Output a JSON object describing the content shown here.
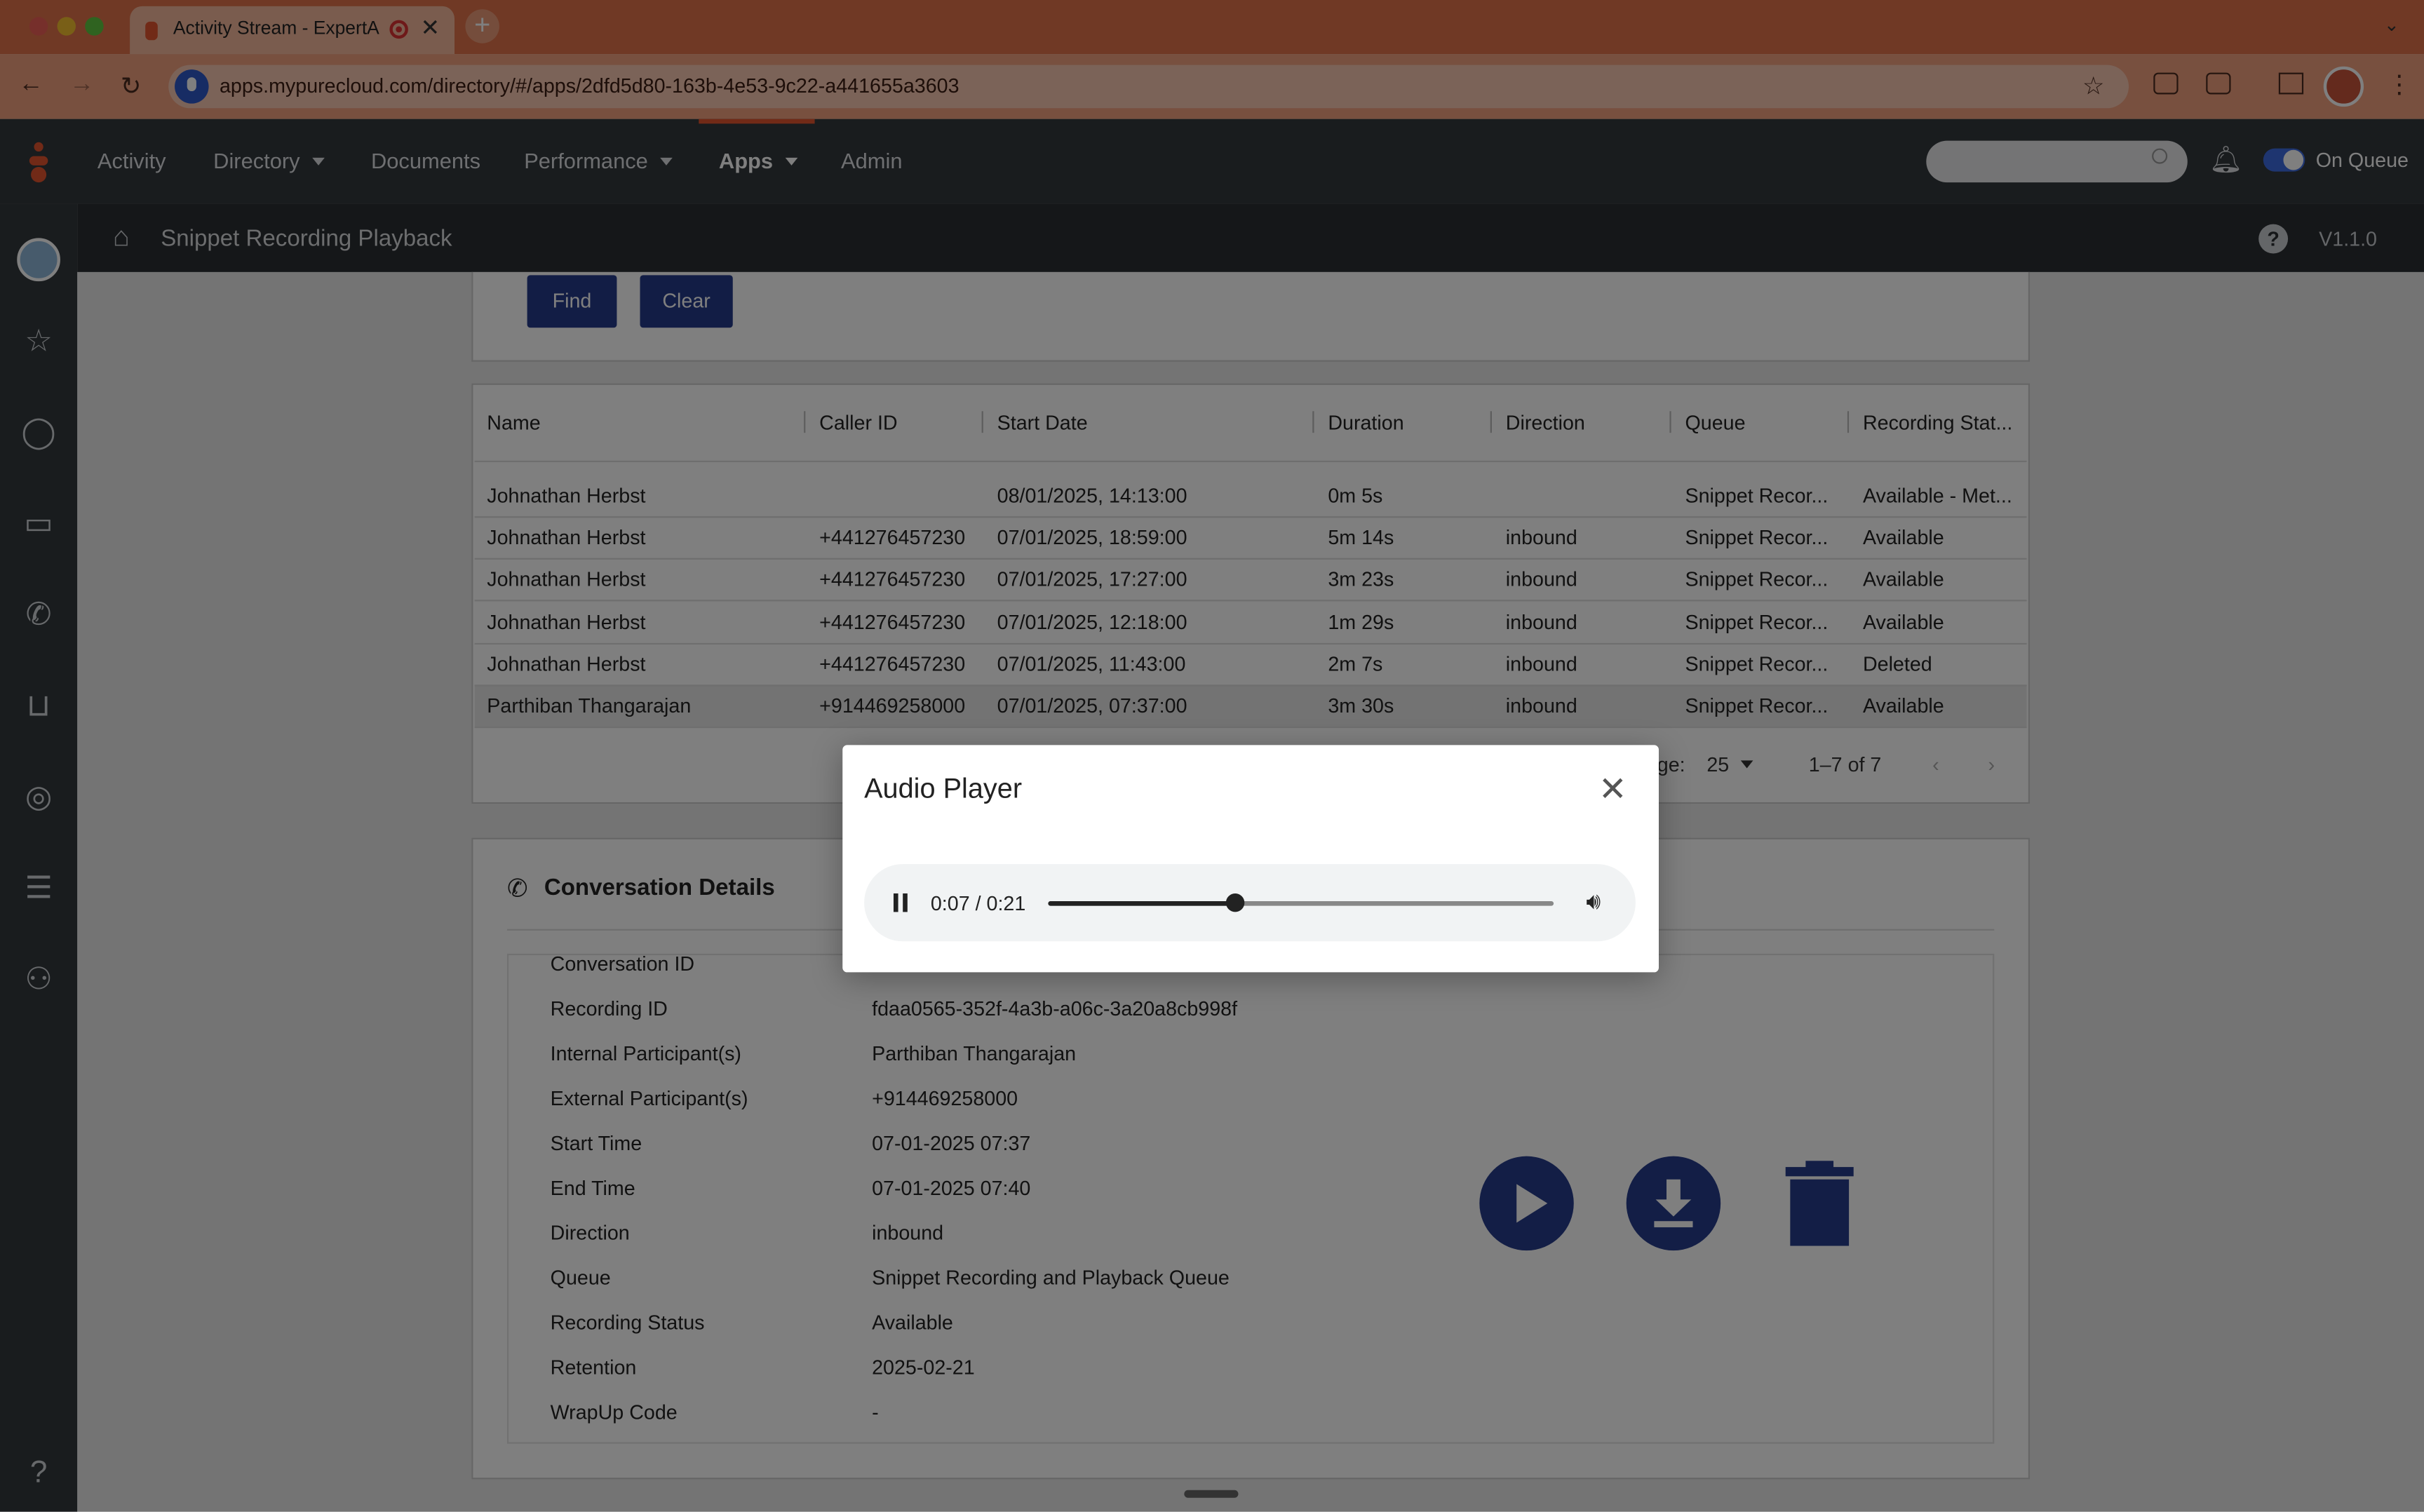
{
  "browser": {
    "tab_title": "Activity Stream - ExpertAp",
    "url": "apps.mypurecloud.com/directory/#/apps/2dfd5d80-163b-4e53-9c22-a441655a3603",
    "new_tab": "+",
    "tab_close": "✕"
  },
  "topnav": {
    "items": [
      "Activity",
      "Directory",
      "Documents",
      "Performance",
      "Apps",
      "Admin"
    ],
    "on_queue_label": "On Queue"
  },
  "app_header": {
    "title": "Snippet Recording Playback",
    "version": "V1.1.0"
  },
  "search_buttons": {
    "find": "Find",
    "clear": "Clear"
  },
  "table": {
    "columns": [
      "Name",
      "Caller ID",
      "Start Date",
      "Duration",
      "Direction",
      "Queue",
      "Recording Stat..."
    ],
    "rows": [
      [
        "Johnathan Herbst",
        "",
        "08/01/2025, 14:13:00",
        "0m 5s",
        "",
        "Snippet Recor...",
        "Available - Met..."
      ],
      [
        "Johnathan Herbst",
        "+441276457230",
        "07/01/2025, 18:59:00",
        "5m 14s",
        "inbound",
        "Snippet Recor...",
        "Available"
      ],
      [
        "Johnathan Herbst",
        "+441276457230",
        "07/01/2025, 17:27:00",
        "3m 23s",
        "inbound",
        "Snippet Recor...",
        "Available"
      ],
      [
        "Johnathan Herbst",
        "+441276457230",
        "07/01/2025, 12:18:00",
        "1m 29s",
        "inbound",
        "Snippet Recor...",
        "Available"
      ],
      [
        "Johnathan Herbst",
        "+441276457230",
        "07/01/2025, 11:43:00",
        "2m 7s",
        "inbound",
        "Snippet Recor...",
        "Deleted"
      ],
      [
        "Parthiban Thangarajan",
        "+914469258000",
        "07/01/2025, 07:37:00",
        "3m 30s",
        "inbound",
        "Snippet Recor...",
        "Available"
      ]
    ],
    "pagination": {
      "per_page_label": "ge:",
      "per_page": "25",
      "range": "1–7 of 7"
    }
  },
  "details": {
    "title": "Conversation Details",
    "fields": [
      {
        "label": "Conversation ID",
        "value": ""
      },
      {
        "label": "Recording ID",
        "value": "fdaa0565-352f-4a3b-a06c-3a20a8cb998f"
      },
      {
        "label": "Internal Participant(s)",
        "value": "Parthiban Thangarajan"
      },
      {
        "label": "External Participant(s)",
        "value": "+914469258000"
      },
      {
        "label": "Start Time",
        "value": "07-01-2025 07:37"
      },
      {
        "label": "End Time",
        "value": "07-01-2025 07:40"
      },
      {
        "label": "Direction",
        "value": "inbound"
      },
      {
        "label": "Queue",
        "value": "Snippet Recording and Playback Queue"
      },
      {
        "label": "Recording Status",
        "value": "Available"
      },
      {
        "label": "Retention",
        "value": "2025-02-21"
      },
      {
        "label": "WrapUp Code",
        "value": "-"
      }
    ]
  },
  "modal": {
    "title": "Audio Player",
    "time": "0:07 / 0:21",
    "progress_fraction": 0.37
  },
  "colors": {
    "accent": "#e2552e",
    "primary": "#253a8a"
  }
}
